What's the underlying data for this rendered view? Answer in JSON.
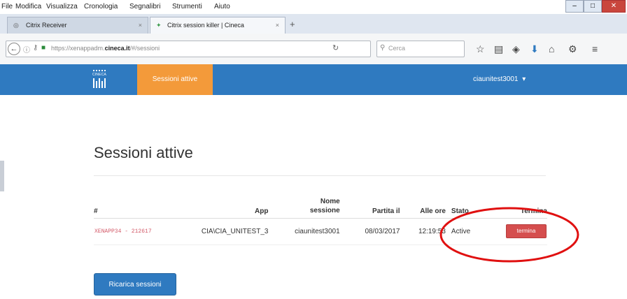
{
  "menubar": {
    "items": [
      "File",
      "Modifica",
      "Visualizza",
      "Cronologia",
      "Segnalibri",
      "Strumenti",
      "Aiuto"
    ]
  },
  "window": {
    "minimize": "–",
    "maximize": "□",
    "close": "✕"
  },
  "tabs": [
    {
      "label": "Citrix Receiver"
    },
    {
      "label": "Citrix session killer | Cineca"
    }
  ],
  "tab_close": "×",
  "new_tab": "+",
  "address": {
    "url_prefix": "https://xenappadm.",
    "url_domain": "cineca.it",
    "url_suffix": "/#/sessioni",
    "reload_icon": "reload-icon",
    "search_placeholder": "Cerca"
  },
  "app": {
    "logo_text": "CINECA",
    "nav_tab": "Sessioni attive",
    "user_menu": "ciaunitest3001",
    "user_caret": "▾"
  },
  "page": {
    "title": "Sessioni attive",
    "reload_button": "Ricarica sessioni"
  },
  "table": {
    "headers": {
      "num": "#",
      "app": "App",
      "session_name_1": "Nome",
      "session_name_2": "sessione",
      "started": "Partita il",
      "time": "Alle ore",
      "status": "Stato",
      "terminate": "Termina"
    },
    "rows": [
      {
        "id": "XENAPP34 - 212617",
        "app": "CIA\\CIA_UNITEST_3",
        "session": "ciaunitest3001",
        "started": "08/03/2017",
        "time": "12:19:53",
        "status": "Active",
        "action": "termina"
      }
    ]
  },
  "colors": {
    "brand_blue": "#2f7ac0",
    "active_tab_orange": "#f39a3a",
    "terminate_red": "#d54e4e",
    "annotation_circle": "#e01010"
  }
}
